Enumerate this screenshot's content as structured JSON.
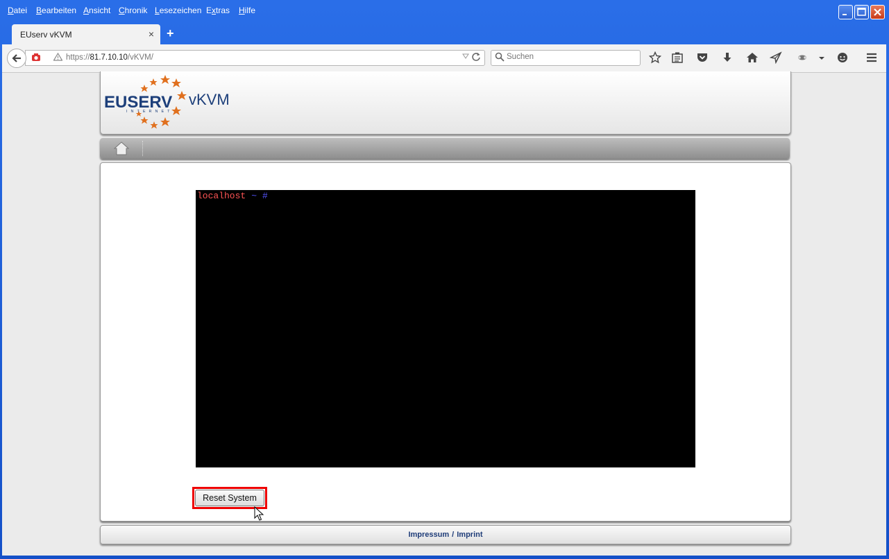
{
  "menu": [
    "Datei",
    "Bearbeiten",
    "Ansicht",
    "Chronik",
    "Lesezeichen",
    "Extras",
    "Hilfe"
  ],
  "menu_accels": [
    "D",
    "B",
    "A",
    "C",
    "L",
    "x",
    "H"
  ],
  "tab": {
    "title": "EUserv vKVM",
    "close": "×"
  },
  "new_tab": "+",
  "address": {
    "prefix": "https://",
    "host": "81.7.10.10",
    "path": "/vKVM/"
  },
  "search": {
    "placeholder": "Suchen"
  },
  "logo": {
    "brand": "EUSERV",
    "sub": "INTERNET",
    "product": "vKVM"
  },
  "console": {
    "host": "localhost",
    "tilde": "~",
    "hash": "#"
  },
  "reset_label": "Reset System",
  "footer": {
    "impressum": "Impressum",
    "sep": "/",
    "imprint": "Imprint"
  },
  "colors": {
    "window_chrome": "#2a6ee8",
    "highlight_box": "#e00000",
    "console_bg": "#000000",
    "prompt_host": "#ff5555",
    "prompt_symbols": "#5555ff",
    "footer_link": "#1e3c78"
  }
}
